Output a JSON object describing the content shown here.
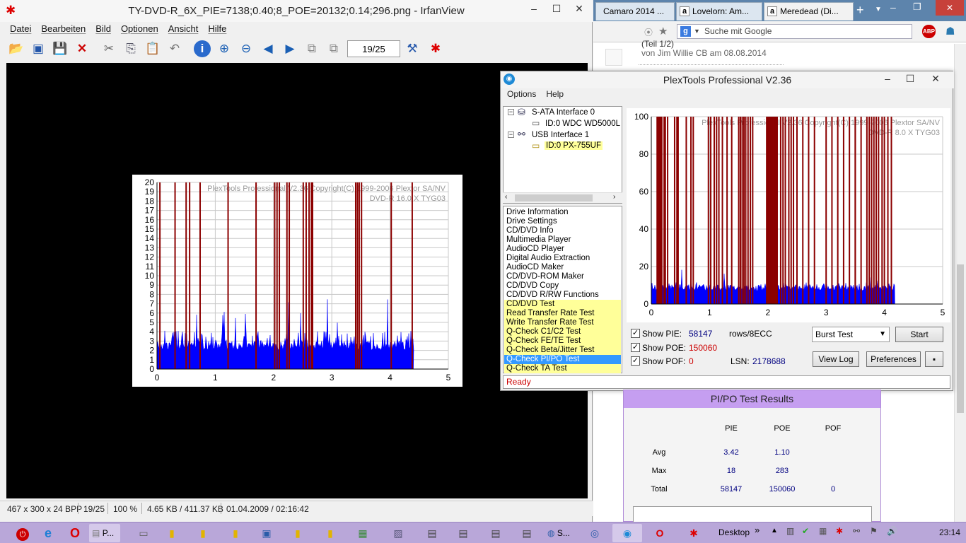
{
  "irfan": {
    "title": "TY-DVD-R_6X_PIE=7138;0.40;8_POE=20132;0.14;296.png - IrfanView",
    "menu": [
      "Datei",
      "Bearbeiten",
      "Bild",
      "Optionen",
      "Ansicht",
      "Hilfe"
    ],
    "page_input": "19/25",
    "status": {
      "dims": "467 x 300 x 24 BPP",
      "index": "19/25",
      "zoom": "100 %",
      "size": "4.65 KB / 411.37 KB",
      "date": "01.04.2009 / 02:16:42"
    },
    "chart_data": {
      "type": "bar",
      "watermark": [
        "PlexTools Professional V2.36 Copyright(C) 1999-2006 Plextor SA/NV",
        "DVD-R    16.0 X    TYG03"
      ],
      "ylim": [
        0,
        20
      ],
      "yticks": [
        "0",
        "1",
        "2",
        "3",
        "4",
        "5",
        "6",
        "7",
        "8",
        "9",
        "10",
        "11",
        "12",
        "13",
        "14",
        "15",
        "16",
        "17",
        "18",
        "19",
        "20"
      ],
      "xlim": [
        0,
        5
      ],
      "xticks": [
        "0",
        "1",
        "2",
        "3",
        "4",
        "5"
      ],
      "pi_baseline": 2,
      "pi_max": 8,
      "data_end": 4.4,
      "po_spikes_x": [
        0.05,
        0.31,
        0.5,
        0.56,
        0.74,
        1.22,
        1.7,
        2.02,
        2.06,
        2.1,
        2.23,
        2.27,
        2.51,
        2.56,
        2.61,
        2.65,
        2.67,
        3.41,
        3.44,
        3.47,
        3.51,
        4.02,
        4.38
      ]
    }
  },
  "browser": {
    "tabs": [
      "Camaro 2014 ...",
      "Lovelorn: Am...",
      "Meredead (Di..."
    ],
    "search_placeholder": "Suche mit Google",
    "comment_meta": "von Jim Willie CB am 08.08.2014",
    "comment_author": "Jim Willie CB",
    "comment_title": "(Teil 1/2)"
  },
  "plex": {
    "title": "PlexTools Professional V2.36",
    "menu": [
      "Options",
      "Help"
    ],
    "tree": {
      "sata": "S-ATA Interface 0",
      "sata_dev": "ID:0  WDC WD5000L",
      "usb": "USB Interface 1",
      "usb_dev": "ID:0  PX-755UF"
    },
    "functions": [
      "Drive Information",
      "Drive Settings",
      "CD/DVD Info",
      "Multimedia Player",
      "AudioCD Player",
      "Digital Audio Extraction",
      "AudioCD Maker",
      "CD/DVD-ROM Maker",
      "CD/DVD Copy",
      "CD/DVD R/RW Functions",
      "CD/DVD Test",
      "Read Transfer Rate Test",
      "Write Transfer Rate Test",
      "Q-Check C1/C2 Test",
      "Q-Check FE/TE Test",
      "Q-Check Beta/Jitter Test",
      "Q-Check PI/PO Test",
      "Q-Check TA Test"
    ],
    "selected_function": "Q-Check PI/PO Test",
    "controls": {
      "show_pie_label": "Show PIE:",
      "show_pie_value": "58147",
      "rows_label": "rows/8ECC",
      "show_poe_label": "Show POE:",
      "show_poe_value": "150060",
      "show_pof_label": "Show POF:",
      "show_pof_value": "0",
      "lsn_label": "LSN:",
      "lsn_value": "2178688",
      "mode_select": "Burst Test",
      "start": "Start",
      "view_log": "View Log",
      "preferences": "Preferences"
    },
    "status": "Ready",
    "chart_data": {
      "type": "bar",
      "watermark": [
        "PlexTools Professional V2.36 Copyright(C) 1999-2006 Plextor SA/NV",
        "DVD-R    8.0 X    TYG03"
      ],
      "ylim": [
        0,
        100
      ],
      "yticks": [
        "0",
        "20",
        "40",
        "60",
        "80",
        "100"
      ],
      "xlim": [
        0,
        5
      ],
      "xticks": [
        "0",
        "1",
        "2",
        "3",
        "4",
        "5"
      ],
      "pi_baseline": 7,
      "pi_max": 20,
      "data_end": 4.18,
      "po_spikes_x": [
        0.1,
        0.12,
        0.14,
        0.16,
        0.18,
        0.22,
        0.24,
        0.28,
        0.4,
        0.44,
        0.46,
        0.6,
        0.68,
        0.72,
        0.98,
        1.02,
        1.08,
        1.12,
        1.16,
        1.22,
        1.3,
        1.38,
        1.5,
        1.53,
        1.56,
        1.59,
        1.62,
        1.66,
        1.7,
        1.74,
        1.98,
        2.0,
        2.02,
        2.04,
        2.06,
        2.08,
        2.1,
        2.12,
        2.14,
        2.16,
        2.22,
        2.26,
        2.3,
        2.36,
        2.4,
        2.44,
        2.5,
        2.6,
        2.7,
        2.8,
        3.0,
        3.1,
        3.2,
        3.3,
        3.4,
        3.5,
        3.5,
        3.6,
        3.7,
        3.74,
        3.78,
        3.82,
        3.86,
        3.9,
        3.96,
        4.0,
        4.06,
        4.12
      ]
    }
  },
  "pipo": {
    "title": "PI/PO Test Results",
    "headers": [
      "PIE",
      "POE",
      "POF"
    ],
    "rows": [
      {
        "label": "Avg",
        "pie": "3.42",
        "poe": "1.10",
        "pof": ""
      },
      {
        "label": "Max",
        "pie": "18",
        "poe": "283",
        "pof": ""
      },
      {
        "label": "Total",
        "pie": "58147",
        "poe": "150060",
        "pof": "0"
      }
    ]
  },
  "taskbar": {
    "desktop": "Desktop",
    "clock": "23:14",
    "pinned": [
      "P...",
      "S..."
    ]
  },
  "colors": {
    "pi": "#0000ff",
    "po": "#8b0000",
    "selection": "#3399ff",
    "highlight": "#ffff99",
    "pipo_header": "#c59ef0",
    "taskbar": "#b9a7d9"
  }
}
